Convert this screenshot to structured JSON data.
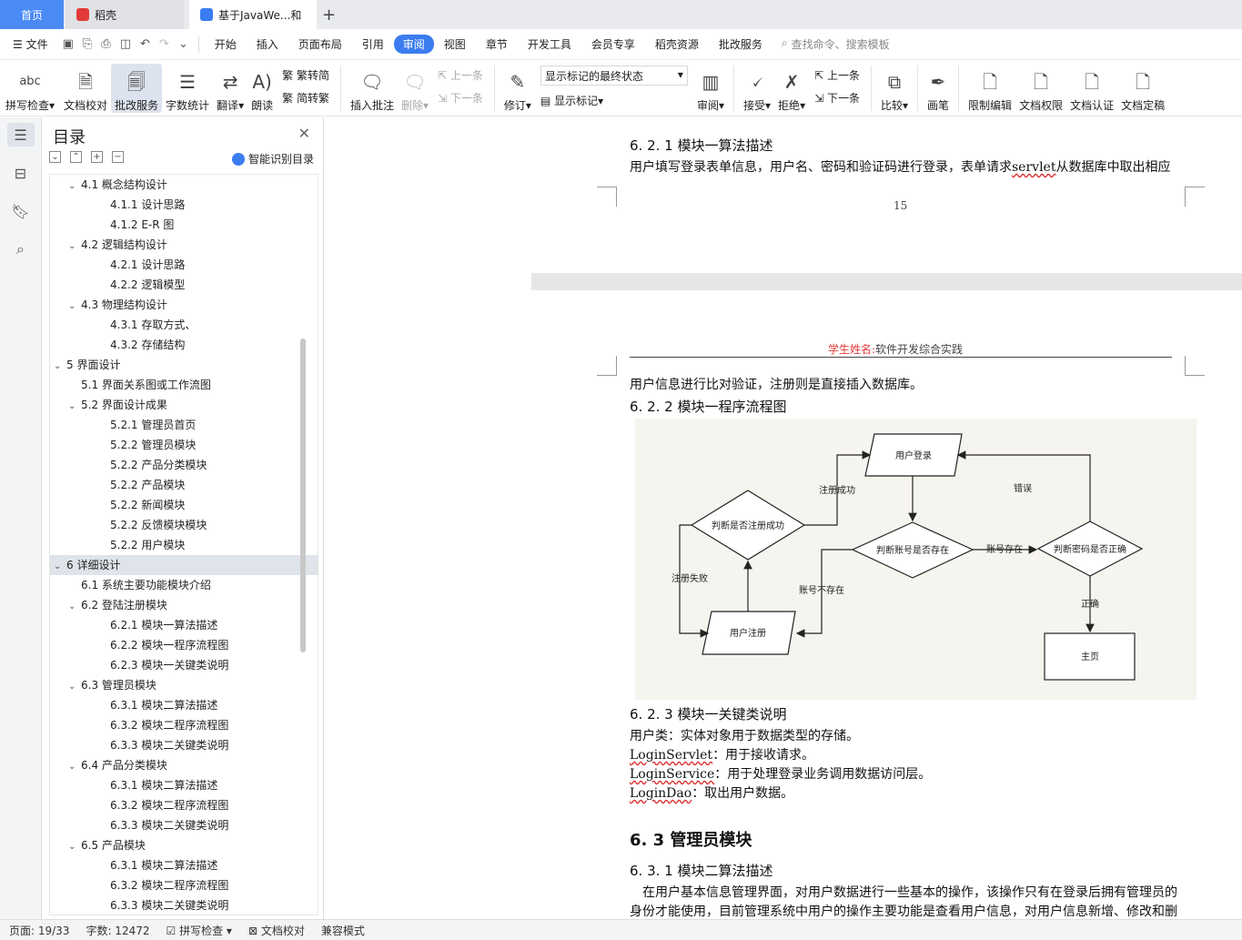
{
  "tabs": {
    "home": "首页",
    "daoke": "稻壳",
    "doc": "基于JavaWe...和",
    "add": "+"
  },
  "menu": {
    "file": "文件",
    "items": [
      "开始",
      "插入",
      "页面布局",
      "引用",
      "审阅",
      "视图",
      "章节",
      "开发工具",
      "会员专享",
      "稻壳资源",
      "批改服务"
    ],
    "active_index": 4,
    "search": "查找命令、搜索模板"
  },
  "ribbon": {
    "spell": "拼写检查",
    "spell_icon_text": "abc",
    "proof": "文档校对",
    "review_service": "批改服务",
    "word_count": "字数统计",
    "translate": "翻译",
    "read": "朗读",
    "to_trad": "繁转简",
    "to_simp": "简转繁",
    "insert_comment": "插入批注",
    "delete": "删除",
    "prev": "上一条",
    "next": "下一条",
    "revise": "修订",
    "markup_state": "显示标记的最终状态",
    "show_markup": "显示标记",
    "review": "审阅",
    "accept": "接受",
    "reject": "拒绝",
    "prev2": "上一条",
    "next2": "下一条",
    "compare": "比较",
    "pen": "画笔",
    "restrict": "限制编辑",
    "permission": "文档权限",
    "certify": "文档认证",
    "finalize": "文档定稿"
  },
  "toc": {
    "title": "目录",
    "smart": "智能识别目录",
    "items": [
      {
        "level": 2,
        "caret": true,
        "text": "4.1  概念结构设计"
      },
      {
        "level": 3,
        "caret": false,
        "text": "4.1.1  设计思路"
      },
      {
        "level": 3,
        "caret": false,
        "text": "4.1.2 E-R 图"
      },
      {
        "level": 2,
        "caret": true,
        "text": "4.2  逻辑结构设计"
      },
      {
        "level": 3,
        "caret": false,
        "text": "4.2.1  设计思路"
      },
      {
        "level": 3,
        "caret": false,
        "text": "4.2.2  逻辑模型"
      },
      {
        "level": 2,
        "caret": true,
        "text": "4.3  物理结构设计"
      },
      {
        "level": 3,
        "caret": false,
        "text": "4.3.1  存取方式、"
      },
      {
        "level": 3,
        "caret": false,
        "text": "4.3.2  存储结构"
      },
      {
        "level": 1,
        "caret": true,
        "text": "5  界面设计"
      },
      {
        "level": 2,
        "caret": false,
        "text": "5.1  界面关系图或工作流图"
      },
      {
        "level": 2,
        "caret": true,
        "text": "5.2  界面设计成果"
      },
      {
        "level": 3,
        "caret": false,
        "text": "5.2.1  管理员首页"
      },
      {
        "level": 3,
        "caret": false,
        "text": "5.2.2  管理员模块"
      },
      {
        "level": 3,
        "caret": false,
        "text": "5.2.2  产品分类模块"
      },
      {
        "level": 3,
        "caret": false,
        "text": "5.2.2  产品模块"
      },
      {
        "level": 3,
        "caret": false,
        "text": "5.2.2  新闻模块"
      },
      {
        "level": 3,
        "caret": false,
        "text": "5.2.2  反馈模块模块"
      },
      {
        "level": 3,
        "caret": false,
        "text": "5.2.2  用户模块"
      },
      {
        "level": 1,
        "caret": true,
        "text": "6  详细设计",
        "selected": true
      },
      {
        "level": 2,
        "caret": false,
        "text": "6.1  系统主要功能模块介绍"
      },
      {
        "level": 2,
        "caret": true,
        "text": "6.2  登陆注册模块"
      },
      {
        "level": 3,
        "caret": false,
        "text": "6.2.1  模块一算法描述"
      },
      {
        "level": 3,
        "caret": false,
        "text": "6.2.2  模块一程序流程图"
      },
      {
        "level": 3,
        "caret": false,
        "text": "6.2.3  模块一关键类说明"
      },
      {
        "level": 2,
        "caret": true,
        "text": "6.3    管理员模块"
      },
      {
        "level": 3,
        "caret": false,
        "text": "6.3.1  模块二算法描述"
      },
      {
        "level": 3,
        "caret": false,
        "text": "6.3.2  模块二程序流程图"
      },
      {
        "level": 3,
        "caret": false,
        "text": "6.3.3  模块二关键类说明"
      },
      {
        "level": 2,
        "caret": true,
        "text": "6.4    产品分类模块"
      },
      {
        "level": 3,
        "caret": false,
        "text": "6.3.1  模块二算法描述"
      },
      {
        "level": 3,
        "caret": false,
        "text": "6.3.2  模块二程序流程图"
      },
      {
        "level": 3,
        "caret": false,
        "text": "6.3.3  模块二关键类说明"
      },
      {
        "level": 2,
        "caret": true,
        "text": "6.5    产品模块"
      },
      {
        "level": 3,
        "caret": false,
        "text": "6.3.1  模块二算法描述"
      },
      {
        "level": 3,
        "caret": false,
        "text": "6.3.2  模块二程序流程图"
      },
      {
        "level": 3,
        "caret": false,
        "text": "6.3.3  模块二关键类说明"
      }
    ]
  },
  "doc": {
    "p1_heading": "6. 2. 1  模块一算法描述",
    "p1_line_a": "用户填写登录表单信息，用户名、密码和验证码进行登录，表单请求",
    "p1_line_servlet": "servlet",
    "p1_line_b": "从数据库中取出相应",
    "page_number": "15",
    "header_label": "学生姓名:",
    "header_text": "软件开发综合实践",
    "p2_line1": "用户信息进行比对验证，注册则是直接插入数据库。",
    "h_622": "6. 2. 2  模块一程序流程图",
    "h_623": "6. 2. 3  模块一关键类说明",
    "cls_user": "用户类：实体对象用于数据类型的存储。",
    "cls_servlet_name": "LoginServlet",
    "cls_servlet_desc": "：用于接收请求。",
    "cls_service_name": "LoginService",
    "cls_service_desc": "：用于处理登录业务调用数据访问层。",
    "cls_dao_name": "LoginDao",
    "cls_dao_desc": "：取出用户数据。",
    "h_63": "6. 3   管理员模块",
    "h_631": "6. 3. 1  模块二算法描述",
    "para_a": "在用户基本信息管理界面，对用户数据进行一些基本的操作，该操作只有在登录后拥有管理员的",
    "para_b": "身份才能使用，目前管理系统中用户的操作主要功能是查看用户信息，对用户信息新增、修改和删"
  },
  "flow": {
    "login": "用户登录",
    "check_registered": "判断是否注册成功",
    "register_ok": "注册成功",
    "error": "错误",
    "check_account": "判断账号是否存在",
    "account_exists": "账号存在",
    "check_password": "判断密码是否正确",
    "register_fail": "注册失败",
    "account_missing": "账号不存在",
    "correct": "正确",
    "register": "用户注册",
    "home": "主页"
  },
  "status": {
    "page": "页面: 19/33",
    "words": "字数: 12472",
    "spell": "拼写检查",
    "proof": "文档校对",
    "compat": "兼容模式"
  },
  "colors": {
    "accent": "#3b7cf0",
    "header_red": "#e23a3a"
  }
}
